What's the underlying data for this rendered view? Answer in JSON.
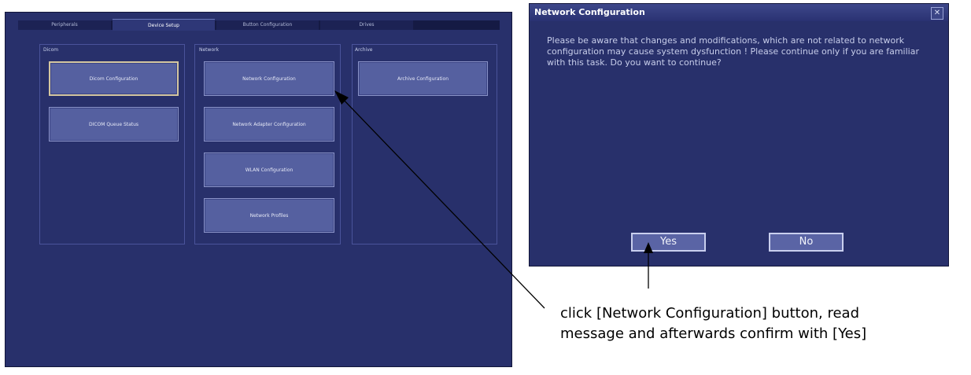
{
  "tabs": [
    "Peripherals",
    "Device Setup",
    "Button Configuration",
    "Drives"
  ],
  "groups": {
    "dicom": {
      "label": "Dicom",
      "buttons": [
        "Dicom Configuration",
        "DICOM Queue Status"
      ]
    },
    "network": {
      "label": "Network",
      "buttons": [
        "Network Configuration",
        "Network Adapter Configuration",
        "WLAN Configuration",
        "Network Profiles"
      ]
    },
    "archive": {
      "label": "Archive",
      "buttons": [
        "Archive Configuration"
      ]
    }
  },
  "dialog": {
    "title": "Network Configuration",
    "message": "Please be aware that changes and modifications, which are  not related to network configuration may cause system dysfunction ! Please continue only if you are familiar with this task. Do you want to continue?",
    "yes_label": "Yes",
    "no_label": "No",
    "close_icon": "close-icon"
  },
  "caption": {
    "line1": "click [Network Configuration] button, read",
    "line2": "message and afterwards confirm with [Yes]"
  },
  "colors": {
    "panel_bg": "#28306b",
    "button_bg": "#5560a0",
    "selected_border": "#d4c6a0"
  }
}
